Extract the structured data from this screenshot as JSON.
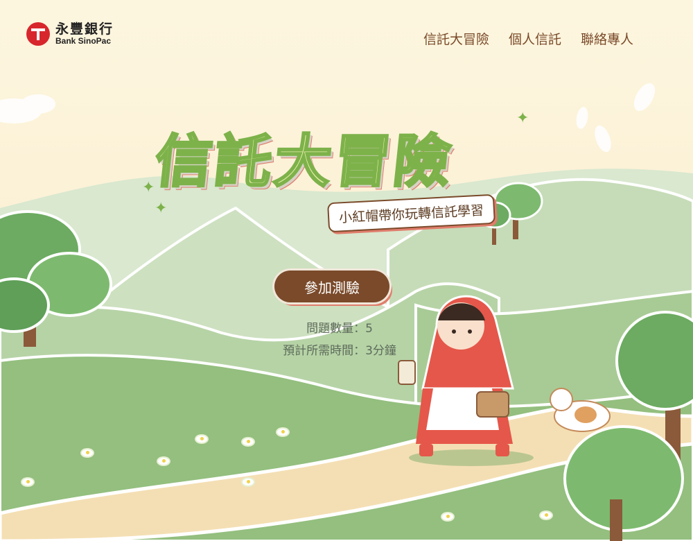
{
  "header": {
    "logo": {
      "name_cn": "永豐銀行",
      "name_en": "Bank SinoPac"
    },
    "nav": [
      {
        "label": "信託大冒險"
      },
      {
        "label": "個人信託"
      },
      {
        "label": "聯絡專人"
      }
    ]
  },
  "hero": {
    "title": "信託大冒險",
    "subtitle": "小紅帽帶你玩轉信託學習"
  },
  "quiz": {
    "cta_label": "參加測驗",
    "question_count": "問題數量：5",
    "estimated_time": "預計所需時間：3分鐘"
  },
  "colors": {
    "accent_brown": "#7a4a2a",
    "brand_red": "#d8262d",
    "grass_green": "#7db24a",
    "background": "#fdf6df"
  },
  "icons": [
    "bank-sinopac-logo-icon",
    "sparkle-icon",
    "flower-icon"
  ]
}
